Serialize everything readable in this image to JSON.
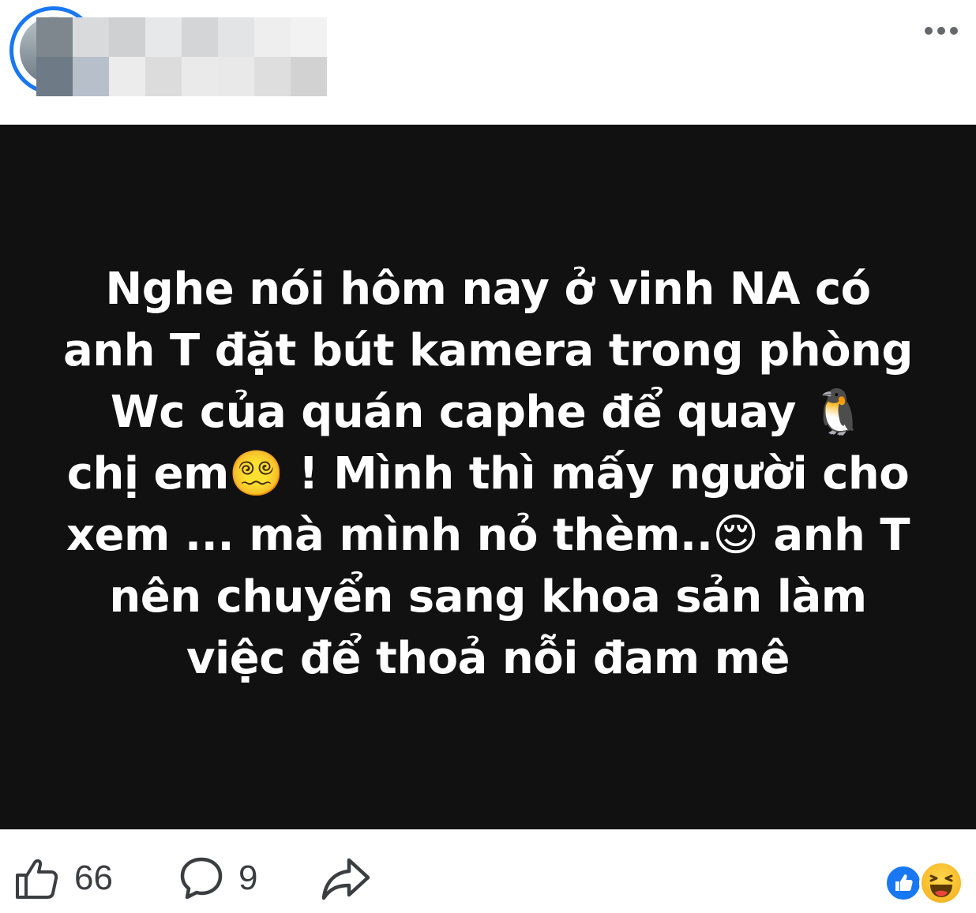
{
  "post": {
    "text": "Nghe nói hôm nay ở vinh NA có\nanh T đặt bút kamera trong phòng\nWc của quán caphe để quay 🐧\nchị em😵‍💫 ! Mình thì mấy người cho\nxem ... mà mình nỏ thèm..😌 anh T\nnên chuyển sang khoa sản làm\nviệc để thoả nỗi đam mê",
    "background_color": "#111111",
    "text_color": "#ffffff"
  },
  "header": {
    "more_icon": "more-horizontal-icon",
    "avatar_ring_color": "#1877f2"
  },
  "footer": {
    "like_count": "66",
    "comment_count": "9",
    "like_icon": "thumbs-up-outline-icon",
    "comment_icon": "speech-bubble-icon",
    "share_icon": "share-arrow-icon",
    "reactions": [
      "like-reaction-icon",
      "haha-reaction-icon"
    ],
    "icon_color": "#3c3d40"
  }
}
